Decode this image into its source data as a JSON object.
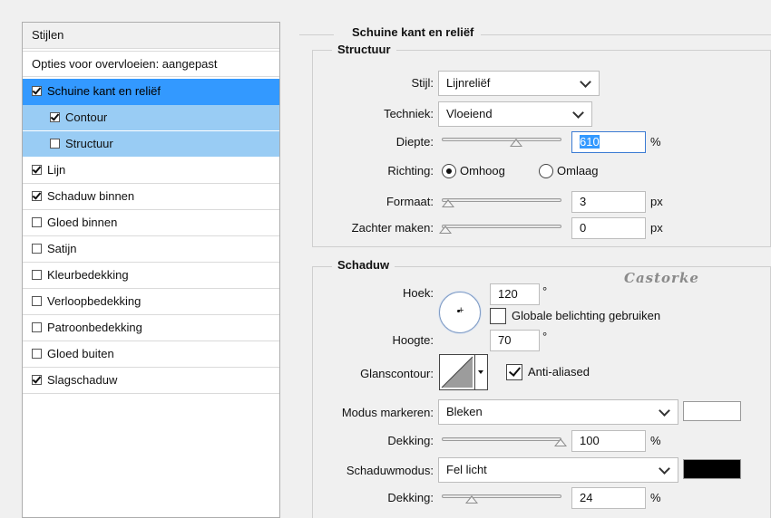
{
  "styles_panel": {
    "header": "Stijlen",
    "blend_options": "Opties voor overvloeien: aangepast",
    "items": [
      {
        "label": "Schuine kant en reliëf",
        "checked": true,
        "state": "selected"
      },
      {
        "label": "Contour",
        "checked": true,
        "state": "sub"
      },
      {
        "label": "Structuur",
        "checked": false,
        "state": "sub"
      },
      {
        "label": "Lijn",
        "checked": true,
        "state": "normal"
      },
      {
        "label": "Schaduw binnen",
        "checked": true,
        "state": "normal"
      },
      {
        "label": "Gloed binnen",
        "checked": false,
        "state": "normal"
      },
      {
        "label": "Satijn",
        "checked": false,
        "state": "normal"
      },
      {
        "label": "Kleurbedekking",
        "checked": false,
        "state": "normal"
      },
      {
        "label": "Verloopbedekking",
        "checked": false,
        "state": "normal"
      },
      {
        "label": "Patroonbedekking",
        "checked": false,
        "state": "normal"
      },
      {
        "label": "Gloed buiten",
        "checked": false,
        "state": "normal"
      },
      {
        "label": "Slagschaduw",
        "checked": true,
        "state": "normal"
      }
    ]
  },
  "bevel": {
    "title": "Schuine kant en reliëf",
    "structure": {
      "title": "Structuur",
      "style_label": "Stijl:",
      "style_value": "Lijnreliëf",
      "technique_label": "Techniek:",
      "technique_value": "Vloeiend",
      "depth_label": "Diepte:",
      "depth_value": "610",
      "depth_unit": "%",
      "direction_label": "Richting:",
      "direction_up": "Omhoog",
      "direction_down": "Omlaag",
      "direction_selected": "Omhoog",
      "size_label": "Formaat:",
      "size_value": "3",
      "size_unit": "px",
      "soften_label": "Zachter maken:",
      "soften_value": "0",
      "soften_unit": "px"
    },
    "shading": {
      "title": "Schaduw",
      "watermark": "Castorke",
      "angle_label": "Hoek:",
      "angle_value": "120",
      "angle_unit": "°",
      "global_light_label": "Globale belichting gebruiken",
      "global_light_checked": false,
      "altitude_label": "Hoogte:",
      "altitude_value": "70",
      "altitude_unit": "°",
      "gloss_label": "Glanscontour:",
      "anti_aliased_label": "Anti-aliased",
      "anti_aliased_checked": true,
      "highlight_mode_label": "Modus markeren:",
      "highlight_mode_value": "Bleken",
      "highlight_color": "#ffffff",
      "highlight_opacity_label": "Dekking:",
      "highlight_opacity_value": "100",
      "highlight_opacity_unit": "%",
      "shadow_mode_label": "Schaduwmodus:",
      "shadow_mode_value": "Fel licht",
      "shadow_color": "#000000",
      "shadow_opacity_label": "Dekking:",
      "shadow_opacity_value": "24",
      "shadow_opacity_unit": "%"
    }
  }
}
